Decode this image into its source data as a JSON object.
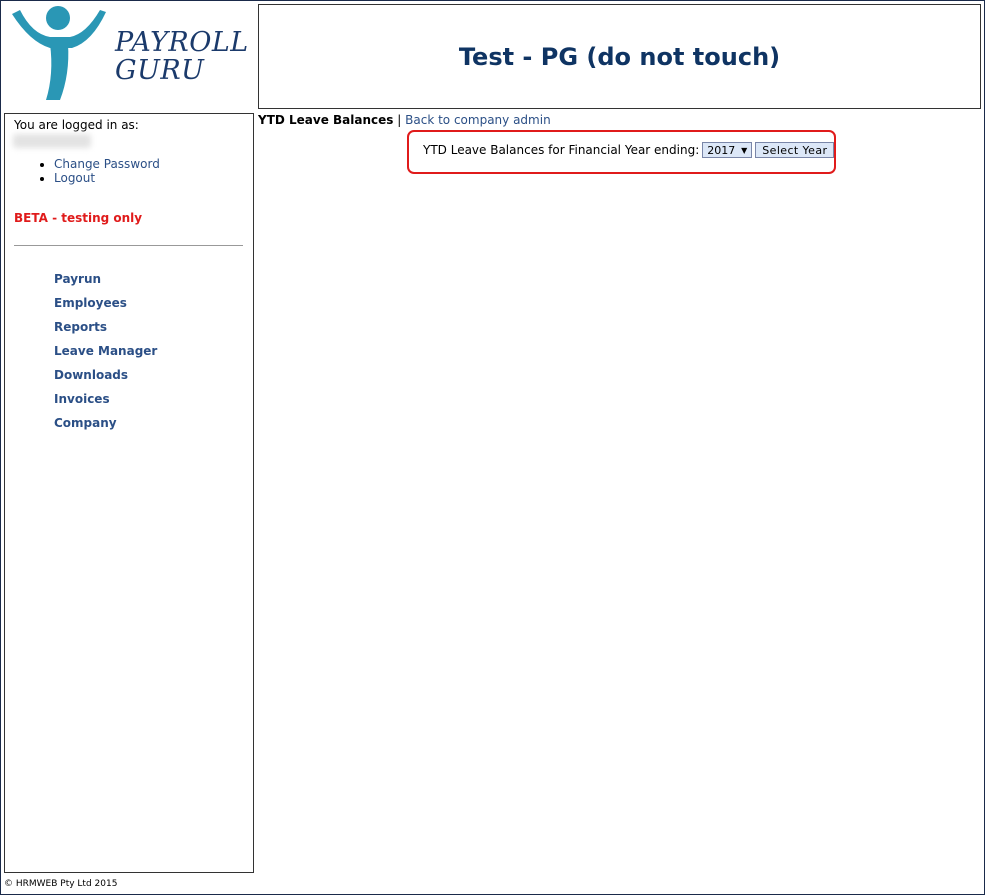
{
  "brand": {
    "line1": "PAYROLL",
    "line2": "GURU",
    "logo_color": "#2a97b5",
    "text_color": "#1b3a6b"
  },
  "header": {
    "title": "Test - PG (do not touch)"
  },
  "sidebar": {
    "logged_in_label": "You are logged in as:",
    "account_links": [
      {
        "label": "Change Password"
      },
      {
        "label": "Logout"
      }
    ],
    "beta_notice": "BETA - testing only",
    "nav": [
      {
        "label": "Payrun"
      },
      {
        "label": "Employees"
      },
      {
        "label": "Reports"
      },
      {
        "label": "Leave Manager"
      },
      {
        "label": "Downloads"
      },
      {
        "label": "Invoices"
      },
      {
        "label": "Company"
      }
    ]
  },
  "breadcrumb": {
    "current": "YTD Leave Balances",
    "separator": "|",
    "back_link": "Back to company admin"
  },
  "form": {
    "label": "YTD Leave Balances for Financial Year ending:",
    "selected_year": "2017",
    "submit_label": "Select Year"
  },
  "footer": {
    "copyright": "© HRMWEB Pty Ltd 2015"
  },
  "colors": {
    "accent": "#2b4f86",
    "beta": "#e01b1b",
    "title": "#0f3463",
    "highlight": "#e01b1b"
  }
}
